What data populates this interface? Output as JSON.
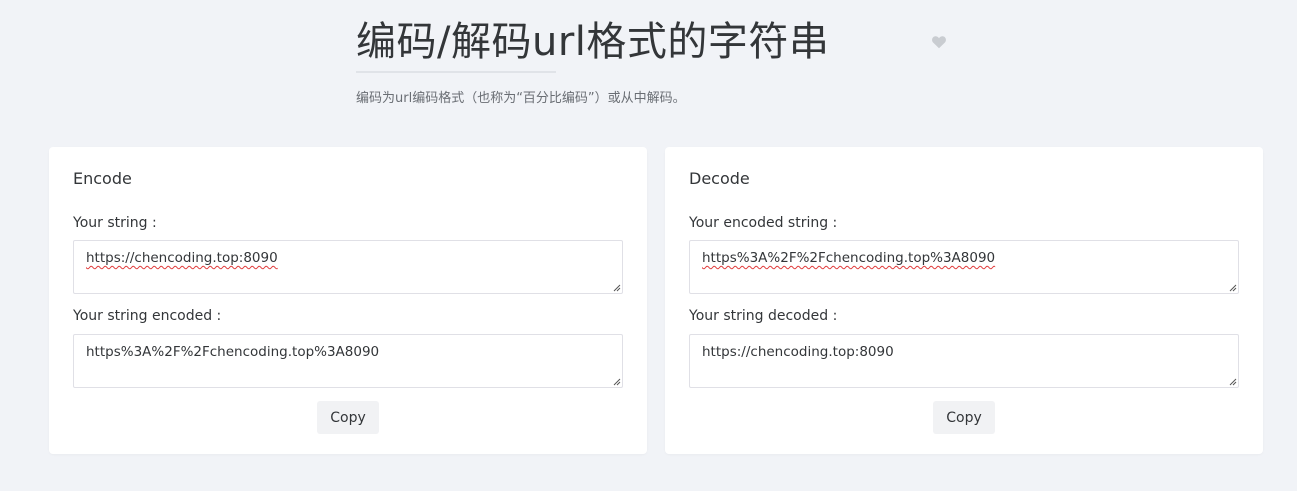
{
  "header": {
    "title": "编码/解码url格式的字符串",
    "subtitle": "编码为url编码格式（也称为“百分比编码”）或从中解码。",
    "favorite_icon": "heart-icon"
  },
  "encode": {
    "title": "Encode",
    "input_label": "Your string :",
    "input_value": "https://chencoding.top:8090",
    "output_label": "Your string encoded :",
    "output_value": "https%3A%2F%2Fchencoding.top%3A8090",
    "copy_label": "Copy"
  },
  "decode": {
    "title": "Decode",
    "input_label": "Your encoded string :",
    "input_value": "https%3A%2F%2Fchencoding.top%3A8090",
    "output_label": "Your string decoded :",
    "output_value": "https://chencoding.top:8090",
    "copy_label": "Copy"
  },
  "colors": {
    "background": "#f1f3f7",
    "card": "#ffffff",
    "text": "#333639",
    "spellcheck": "#e03a3a"
  }
}
